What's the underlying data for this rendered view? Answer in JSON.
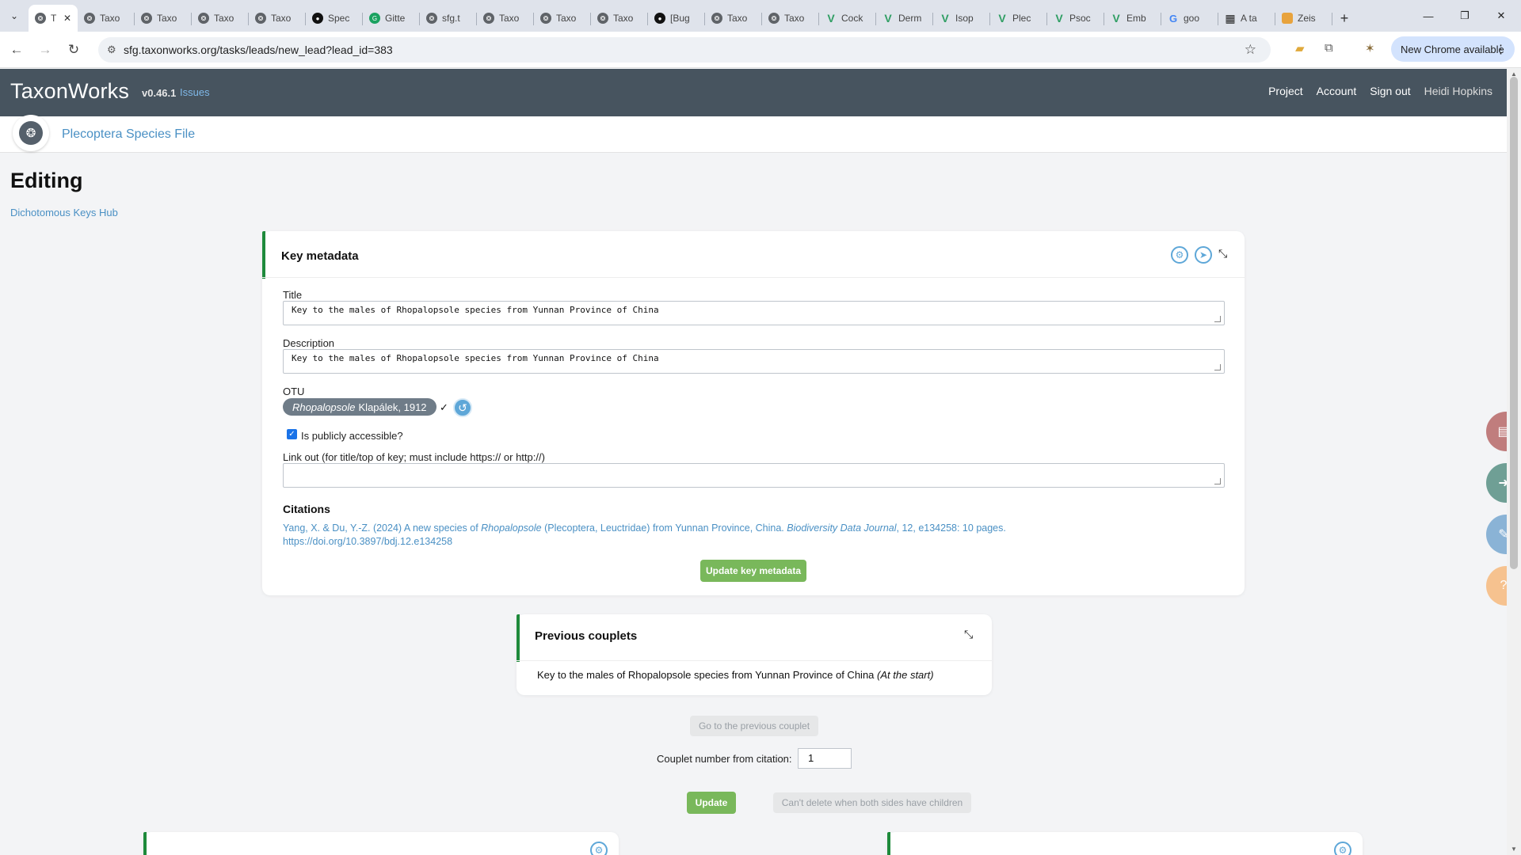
{
  "browser": {
    "tabs": [
      {
        "label": "T",
        "icon": "taxonworks-icon",
        "active": true
      },
      {
        "label": "Taxo",
        "icon": "taxonworks-icon"
      },
      {
        "label": "Taxo",
        "icon": "taxonworks-icon"
      },
      {
        "label": "Taxo",
        "icon": "taxonworks-icon"
      },
      {
        "label": "Taxo",
        "icon": "taxonworks-icon"
      },
      {
        "label": "Spec",
        "icon": "github-icon"
      },
      {
        "label": "Gitte",
        "icon": "gitter-icon"
      },
      {
        "label": "sfg.t",
        "icon": "taxonworks-icon"
      },
      {
        "label": "Taxo",
        "icon": "taxonworks-icon"
      },
      {
        "label": "Taxo",
        "icon": "taxonworks-icon"
      },
      {
        "label": "Taxo",
        "icon": "taxonworks-icon"
      },
      {
        "label": "[Bug",
        "icon": "github-icon"
      },
      {
        "label": "Taxo",
        "icon": "taxonworks-icon"
      },
      {
        "label": "Taxo",
        "icon": "taxonworks-icon"
      },
      {
        "label": "Cock",
        "icon": "v-icon"
      },
      {
        "label": "Derm",
        "icon": "v-icon"
      },
      {
        "label": "Isop",
        "icon": "v-icon"
      },
      {
        "label": "Plec",
        "icon": "v-icon"
      },
      {
        "label": "Psoc",
        "icon": "v-icon"
      },
      {
        "label": "Emb",
        "icon": "v-icon"
      },
      {
        "label": "goo",
        "icon": "google-icon"
      },
      {
        "label": "A ta",
        "icon": "grid-icon"
      },
      {
        "label": "Zeis",
        "icon": "gem-icon"
      }
    ],
    "url": "sfg.taxonworks.org/tasks/leads/new_lead?lead_id=383",
    "new_chrome": "New Chrome available"
  },
  "app": {
    "brand": "TaxonWorks",
    "version": "v0.46.1",
    "issues": "Issues",
    "nav": {
      "project": "Project",
      "account": "Account",
      "sign_out": "Sign out",
      "user": "Heidi Hopkins"
    },
    "project_name": "Plecoptera Species File"
  },
  "page": {
    "title": "Editing",
    "hub_link": "Dichotomous Keys Hub"
  },
  "metadata": {
    "heading": "Key metadata",
    "title_label": "Title",
    "title_value": "Key to the males of Rhopalopsole species from Yunnan Province of China",
    "description_label": "Description",
    "description_value": "Key to the males of Rhopalopsole species from Yunnan Province of China",
    "otu_label": "OTU",
    "otu_genus": "Rhopalopsole",
    "otu_author": "Klapálek, 1912",
    "otu_check": "✓",
    "public_label": "Is publicly accessible?",
    "public_checked": true,
    "linkout_label": "Link out (for title/top of key; must include https:// or http://)",
    "linkout_value": "",
    "citations_label": "Citations",
    "citation": {
      "pre": "Yang, X. & Du, Y.-Z. (2024) A new species of ",
      "genus": "Rhopalopsole",
      "mid": " (Plecoptera, Leuctridae) from Yunnan Province, China. ",
      "journal": "Biodiversity Data Journal",
      "post": ", 12, e134258: 10 pages.",
      "doi": "https://doi.org/10.3897/bdj.12.e134258"
    },
    "update_button": "Update key metadata"
  },
  "previous": {
    "heading": "Previous couplets",
    "text": "Key to the males of Rhopalopsole species from Yunnan Province of China",
    "note": "(At the start)",
    "go_prev": "Go to the previous couplet",
    "couplet_label": "Couplet number from citation:",
    "couplet_value": "1",
    "update": "Update",
    "delete": "Can't delete when both sides have children"
  }
}
